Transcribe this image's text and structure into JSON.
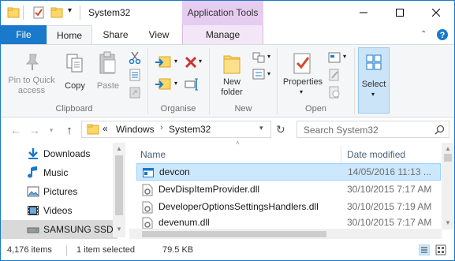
{
  "window": {
    "title": "System32",
    "contextual_tab_group": "Application Tools"
  },
  "ribbon_tabs": [
    "File",
    "Home",
    "Share",
    "View",
    "Manage"
  ],
  "ribbon": {
    "clipboard": {
      "pin_label": "Pin to Quick access",
      "pin_line1": "Pin to Quick",
      "pin_line2": "access",
      "copy": "Copy",
      "paste": "Paste",
      "group": "Clipboard"
    },
    "organise": {
      "group": "Organise"
    },
    "new": {
      "folder_line1": "New",
      "folder_line2": "folder",
      "group": "New"
    },
    "open": {
      "properties": "Properties",
      "group": "Open"
    },
    "select": {
      "label": "Select"
    }
  },
  "address": {
    "overflow": "«",
    "crumbs": [
      "Windows",
      "System32"
    ],
    "search_placeholder": "Search System32"
  },
  "nav_pane": [
    {
      "label": "Downloads",
      "icon": "download-icon"
    },
    {
      "label": "Music",
      "icon": "music-icon"
    },
    {
      "label": "Pictures",
      "icon": "pictures-icon"
    },
    {
      "label": "Videos",
      "icon": "videos-icon"
    },
    {
      "label": "SAMSUNG SSD (",
      "icon": "drive-icon",
      "selected": true
    }
  ],
  "file_list": {
    "columns": [
      "Name",
      "Date modified"
    ],
    "rows": [
      {
        "name": "devcon",
        "date": "14/05/2016 11:13 ...",
        "selected": true,
        "icon": "application-icon"
      },
      {
        "name": "DevDispItemProvider.dll",
        "date": "30/10/2015 7:17 AM",
        "icon": "dll-icon"
      },
      {
        "name": "DeveloperOptionsSettingsHandlers.dll",
        "date": "30/10/2015 7:19 AM",
        "icon": "dll-icon"
      },
      {
        "name": "devenum.dll",
        "date": "30/10/2015 7:17 AM",
        "icon": "dll-icon"
      }
    ]
  },
  "status": {
    "item_count": "4,176 items",
    "selection": "1 item selected",
    "size": "79.5 KB"
  },
  "colors": {
    "accent": "#1979ca",
    "context_tab": "#e6ccf0",
    "selection": "#cce8ff"
  }
}
